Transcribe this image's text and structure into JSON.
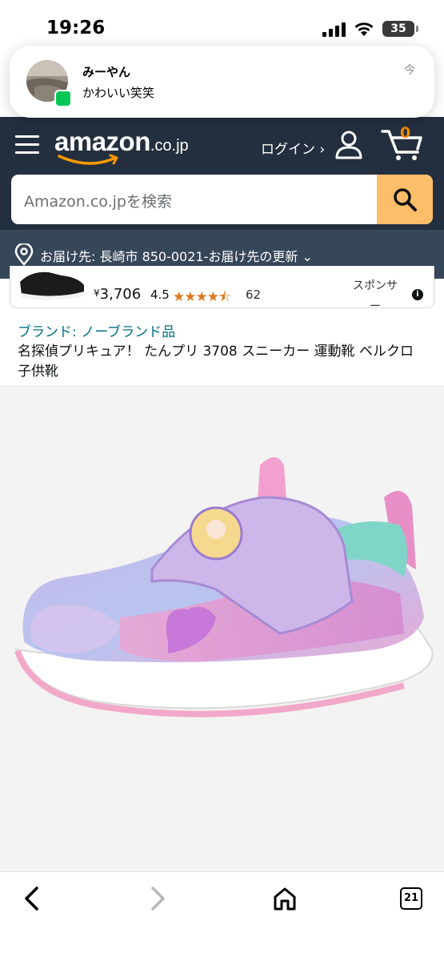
{
  "status_bar": {
    "time": "19:26",
    "battery": "35"
  },
  "notification": {
    "sender": "みーやん",
    "message": "かわいい笑笑",
    "time": "今",
    "app_icon": "line-icon"
  },
  "header": {
    "logo": "amazon",
    "logo_tld": ".co.jp",
    "login_label": "ログイン ›",
    "cart_count": "0"
  },
  "search": {
    "placeholder": "Amazon.co.jpを検索"
  },
  "delivery": {
    "text": "お届け先: 長崎市 850-0021‐お届け先の更新 ⌄"
  },
  "sponsored_item": {
    "yen": "¥",
    "price": "3,706",
    "rating": "4.5",
    "stars": "★★★★⯪",
    "review_count": "62",
    "sponsored_label": "スポンサー",
    "info_icon": "i"
  },
  "product": {
    "brand": "ブランド: ノーブランド品",
    "title": "名探偵プリキュア！ たんプリ 3708 スニーカー 運動靴 ベルクロ 子供靴"
  },
  "toolbar": {
    "tabs_count": "21"
  },
  "colors": {
    "header_bg": "#232f3e",
    "delivery_bg": "#37475a",
    "search_btn": "#febd69",
    "link": "#007185",
    "star": "#de7921",
    "cart_count": "#f08804"
  }
}
